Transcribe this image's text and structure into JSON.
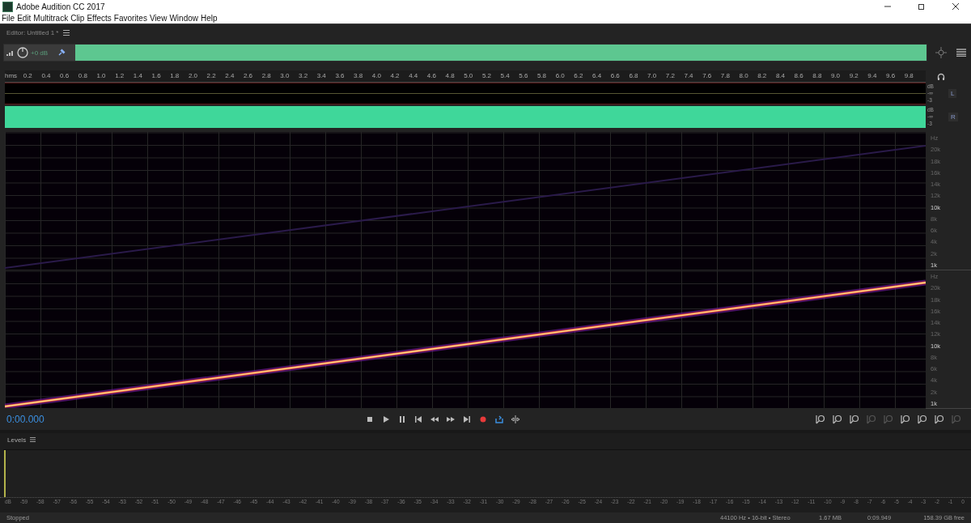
{
  "window": {
    "title": "Adobe Audition CC 2017"
  },
  "menu": [
    "File",
    "Edit",
    "Multitrack",
    "Clip",
    "Effects",
    "Favorites",
    "View",
    "Window",
    "Help"
  ],
  "editor": {
    "title": "Editor: Untitled 1 *"
  },
  "overview": {
    "volume": "+0 dB"
  },
  "ruler": [
    "hms",
    "0.2",
    "0.4",
    "0.6",
    "0.8",
    "1.0",
    "1.2",
    "1.4",
    "1.6",
    "1.8",
    "2.0",
    "2.2",
    "2.4",
    "2.6",
    "2.8",
    "3.0",
    "3.2",
    "3.4",
    "3.6",
    "3.8",
    "4.0",
    "4.2",
    "4.4",
    "4.6",
    "4.8",
    "5.0",
    "5.2",
    "5.4",
    "5.6",
    "5.8",
    "6.0",
    "6.2",
    "6.4",
    "6.6",
    "6.8",
    "7.0",
    "7.2",
    "7.4",
    "7.6",
    "7.8",
    "8.0",
    "8.2",
    "8.4",
    "8.6",
    "8.8",
    "9.0",
    "9.2",
    "9.4",
    "9.6",
    "9.8"
  ],
  "channels": [
    {
      "label": "L",
      "kind": "silent",
      "db": [
        "dB",
        "-∞",
        "-3"
      ]
    },
    {
      "label": "R",
      "kind": "waveform",
      "db": [
        "dB",
        "-∞",
        "-3"
      ]
    }
  ],
  "spectral": [
    {
      "kind": "faint",
      "hz": [
        "Hz",
        "20k",
        "18k",
        "16k",
        "14k",
        "12k",
        "10k",
        "8k",
        "6k",
        "4k",
        "2k",
        "1k"
      ]
    },
    {
      "kind": "bright",
      "hz": [
        "Hz",
        "20k",
        "18k",
        "16k",
        "14k",
        "12k",
        "10k",
        "8k",
        "6k",
        "4k",
        "2k",
        "1k"
      ]
    }
  ],
  "transport": {
    "time": "0:00.000",
    "buttons": [
      {
        "kind": "stop",
        "on": false
      },
      {
        "kind": "play",
        "on": false
      },
      {
        "kind": "pause",
        "on": false
      },
      {
        "kind": "start",
        "on": false
      },
      {
        "kind": "rewind",
        "on": false
      },
      {
        "kind": "forward",
        "on": false
      },
      {
        "kind": "end",
        "on": false
      },
      {
        "kind": "record",
        "on": false
      },
      {
        "kind": "loop",
        "on": true
      },
      {
        "kind": "skip",
        "on": false
      }
    ],
    "zoom": [
      {
        "disabled": false
      },
      {
        "disabled": false
      },
      {
        "disabled": false
      },
      {
        "disabled": true
      },
      {
        "disabled": true
      },
      {
        "disabled": false
      },
      {
        "disabled": false
      },
      {
        "disabled": false
      },
      {
        "disabled": true
      }
    ]
  },
  "levels": {
    "title": "Levels",
    "scale": [
      "dB",
      "-59",
      "-58",
      "-57",
      "-56",
      "-55",
      "-54",
      "-53",
      "-52",
      "-51",
      "-50",
      "-49",
      "-48",
      "-47",
      "-46",
      "-45",
      "-44",
      "-43",
      "-42",
      "-41",
      "-40",
      "-39",
      "-38",
      "-37",
      "-36",
      "-35",
      "-34",
      "-33",
      "-32",
      "-31",
      "-30",
      "-29",
      "-28",
      "-27",
      "-26",
      "-25",
      "-24",
      "-23",
      "-22",
      "-21",
      "-20",
      "-19",
      "-18",
      "-17",
      "-16",
      "-15",
      "-14",
      "-13",
      "-12",
      "-11",
      "-10",
      "-9",
      "-8",
      "-7",
      "-6",
      "-5",
      "-4",
      "-3",
      "-2",
      "-1",
      "0"
    ]
  },
  "status_bar": {
    "state": "Stopped",
    "format": "44100 Hz • 16-bit • Stereo",
    "size": "1.67 MB",
    "duration": "0:09.949",
    "free": "158.39 GB free"
  }
}
